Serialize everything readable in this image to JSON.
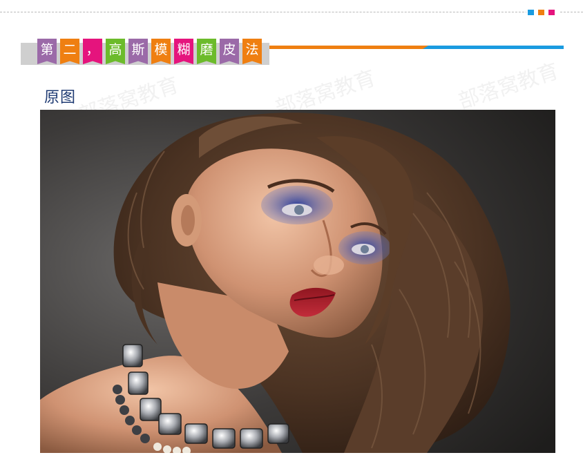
{
  "colors": {
    "purple": "#9b6aa8",
    "orange": "#ef7f11",
    "magenta": "#e5147d",
    "green": "#6cbb2b",
    "blue": "#1a9be0",
    "heading": "#1f3b73"
  },
  "decor": {
    "squares": [
      "#1a9be0",
      "#ef7f11",
      "#e5147d"
    ]
  },
  "title_tags": [
    {
      "char": "第",
      "color": "#9b6aa8"
    },
    {
      "char": "二",
      "color": "#ef7f11"
    },
    {
      "char": "，",
      "color": "#e5147d"
    },
    {
      "char": "高",
      "color": "#6cbb2b"
    },
    {
      "char": "斯",
      "color": "#9b6aa8"
    },
    {
      "char": "模",
      "color": "#ef7f11"
    },
    {
      "char": "糊",
      "color": "#e5147d"
    },
    {
      "char": "磨",
      "color": "#6cbb2b"
    },
    {
      "char": "皮",
      "color": "#9b6aa8"
    },
    {
      "char": "法",
      "color": "#ef7f11"
    }
  ],
  "section": {
    "heading": "原图"
  },
  "photo": {
    "subject": "portrait-photo"
  },
  "watermark": {
    "text": "部落窝教育"
  }
}
